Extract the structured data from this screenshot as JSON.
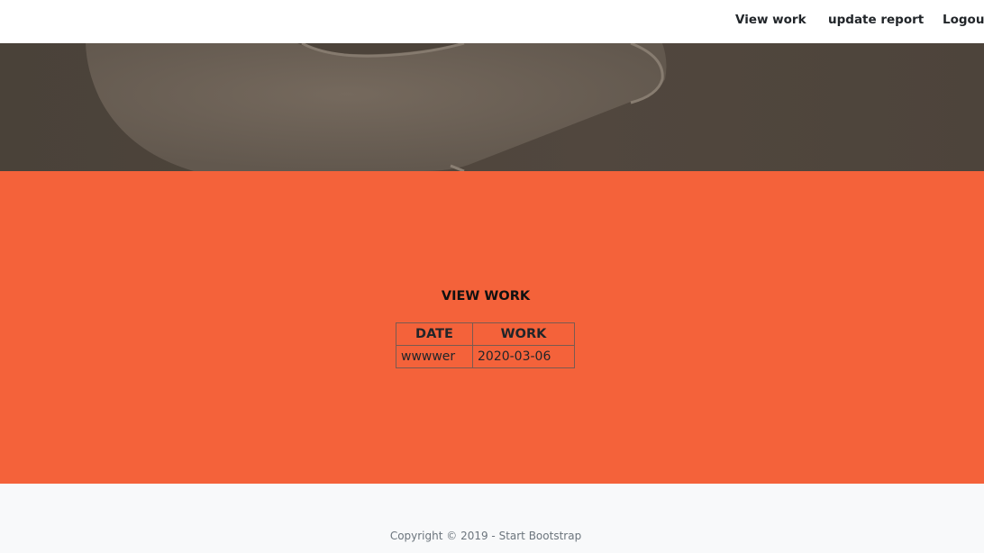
{
  "nav": {
    "items": [
      {
        "label": "View work"
      },
      {
        "label": "update report"
      },
      {
        "label": "Logout"
      }
    ]
  },
  "main": {
    "title": "VIEW WORK",
    "table": {
      "headers": [
        "DATE",
        "WORK"
      ],
      "rows": [
        [
          "wwwwer",
          "2020-03-06"
        ]
      ]
    }
  },
  "footer": {
    "copyright": "Copyright © 2019 - Start Bootstrap"
  },
  "colors": {
    "accent": "#f4623a",
    "footer_bg": "#f8f9fa",
    "hero_bg": "#4f463d"
  }
}
